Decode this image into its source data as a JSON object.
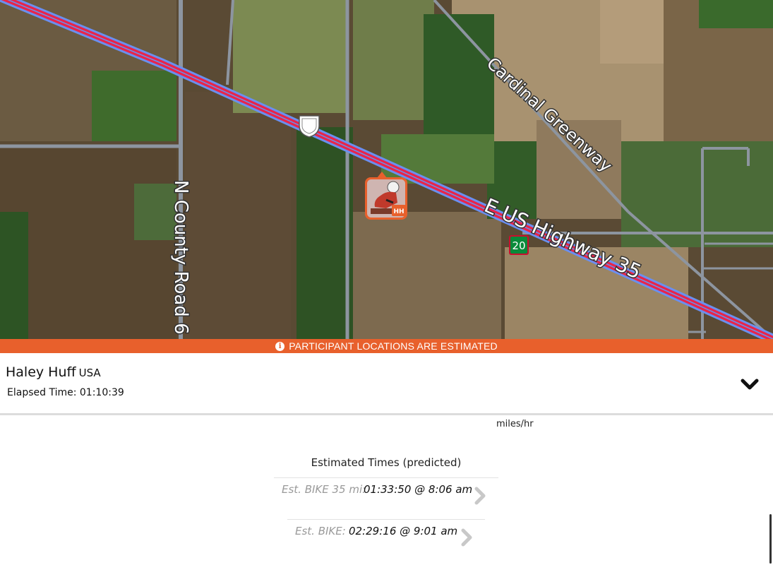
{
  "map": {
    "road_labels": {
      "county_road": "N County Road 6",
      "greenway": "Cardinal Greenway",
      "highway": "E US Highway 35"
    },
    "route_shield": "20",
    "athlete_marker": {
      "initials": "HH"
    },
    "colors": {
      "route_red": "#e8254a",
      "route_blue": "#6a8ff0",
      "shield_green": "#0a8a3a"
    },
    "icons": [
      "highway-shield-icon",
      "athlete-avatar-icon"
    ]
  },
  "banner": {
    "text": "PARTICIPANT LOCATIONS ARE ESTIMATED",
    "icon": "info-icon",
    "color": "#e8602c"
  },
  "athlete": {
    "name": "Haley Huff",
    "country": "USA",
    "elapsed_label": "Elapsed Time:",
    "elapsed_value": "01:10:39",
    "expand_icon": "chevron-down-icon"
  },
  "details": {
    "units": "miles/hr",
    "estimated_title": "Estimated Times (predicted)",
    "rows": [
      {
        "label": "Est. BIKE 35 mi:",
        "value": "01:33:50 @ 8:06 am"
      },
      {
        "label": "Est. BIKE:",
        "value": "02:29:16 @ 9:01 am"
      }
    ]
  }
}
